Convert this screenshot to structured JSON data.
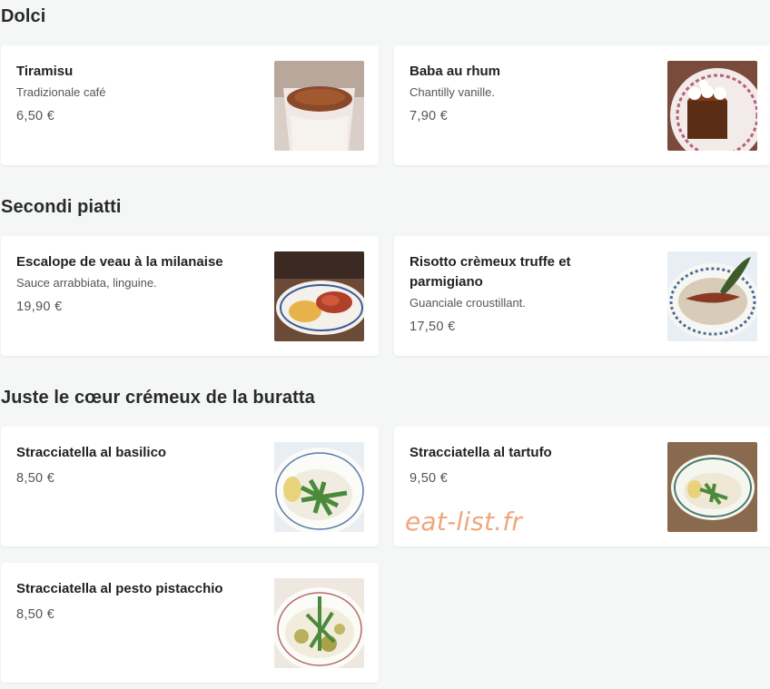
{
  "sections": [
    {
      "title": "Dolci",
      "items": [
        {
          "name": "Tiramisu",
          "description": "Tradizionale café",
          "price": "6,50 €",
          "image": "tiramisu-photo"
        },
        {
          "name": "Baba au rhum",
          "description": "Chantilly vanille.",
          "price": "7,90 €",
          "image": "baba-au-rhum-photo"
        }
      ]
    },
    {
      "title": "Secondi piatti",
      "items": [
        {
          "name": "Escalope de veau à la milanaise",
          "description": "Sauce arrabbiata, linguine.",
          "price": "19,90 €",
          "image": "escalope-photo"
        },
        {
          "name": "Risotto crèmeux truffe et parmigiano",
          "description": "Guanciale croustillant.",
          "price": "17,50 €",
          "image": "risotto-photo"
        }
      ]
    },
    {
      "title": "Juste le cœur crémeux de la buratta",
      "items": [
        {
          "name": "Stracciatella al basilico",
          "description": "",
          "price": "8,50 €",
          "image": "stracciatella-basilico-photo"
        },
        {
          "name": "Stracciatella al tartufo",
          "description": "",
          "price": "9,50 €",
          "image": "stracciatella-tartufo-photo"
        },
        {
          "name": "Stracciatella al pesto pistacchio",
          "description": "",
          "price": "8,50 €",
          "image": "stracciatella-pistacchio-photo"
        }
      ]
    }
  ],
  "watermark": "eat-list.fr",
  "colors": {
    "background": "#f5f6f6",
    "card": "#ffffff",
    "watermark": "#f0a77a"
  }
}
